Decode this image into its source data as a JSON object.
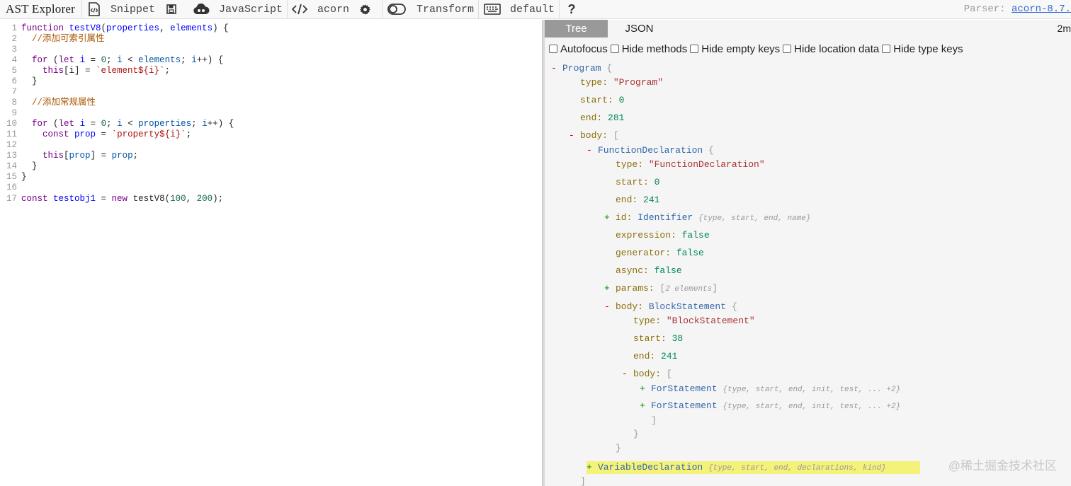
{
  "toolbar": {
    "brand": "AST Explorer",
    "snippet_label": "Snippet",
    "language_label": "JavaScript",
    "parser_label": "acorn",
    "transform_label": "Transform",
    "keymap_label": "default",
    "parser_info_prefix": "Parser: ",
    "parser_info_link": "acorn-8.7."
  },
  "editor": {
    "lines": [
      {
        "n": "1",
        "tokens": [
          [
            "kw",
            "function "
          ],
          [
            "def",
            "testV8"
          ],
          [
            "plain",
            "("
          ],
          [
            "def",
            "properties"
          ],
          [
            "plain",
            ", "
          ],
          [
            "def",
            "elements"
          ],
          [
            "plain",
            ") {"
          ]
        ]
      },
      {
        "n": "2",
        "tokens": [
          [
            "plain",
            "  "
          ],
          [
            "cm",
            "//添加可索引属性"
          ]
        ]
      },
      {
        "n": "3",
        "tokens": []
      },
      {
        "n": "4",
        "tokens": [
          [
            "plain",
            "  "
          ],
          [
            "kw",
            "for"
          ],
          [
            "plain",
            " ("
          ],
          [
            "kw",
            "let "
          ],
          [
            "def",
            "i"
          ],
          [
            "plain",
            " = "
          ],
          [
            "num",
            "0"
          ],
          [
            "plain",
            "; "
          ],
          [
            "var",
            "i"
          ],
          [
            "plain",
            " < "
          ],
          [
            "var",
            "elements"
          ],
          [
            "plain",
            "; "
          ],
          [
            "var",
            "i"
          ],
          [
            "plain",
            "++) {"
          ]
        ]
      },
      {
        "n": "5",
        "tokens": [
          [
            "plain",
            "    "
          ],
          [
            "kw",
            "this"
          ],
          [
            "plain",
            "[i] = "
          ],
          [
            "str",
            "`element${i}`"
          ],
          [
            "plain",
            ";"
          ]
        ]
      },
      {
        "n": "6",
        "tokens": [
          [
            "plain",
            "  }"
          ]
        ]
      },
      {
        "n": "7",
        "tokens": []
      },
      {
        "n": "8",
        "tokens": [
          [
            "plain",
            "  "
          ],
          [
            "cm",
            "//添加常规属性"
          ]
        ]
      },
      {
        "n": "9",
        "tokens": []
      },
      {
        "n": "10",
        "tokens": [
          [
            "plain",
            "  "
          ],
          [
            "kw",
            "for"
          ],
          [
            "plain",
            " ("
          ],
          [
            "kw",
            "let "
          ],
          [
            "def",
            "i"
          ],
          [
            "plain",
            " = "
          ],
          [
            "num",
            "0"
          ],
          [
            "plain",
            "; "
          ],
          [
            "var",
            "i"
          ],
          [
            "plain",
            " < "
          ],
          [
            "var",
            "properties"
          ],
          [
            "plain",
            "; "
          ],
          [
            "var",
            "i"
          ],
          [
            "plain",
            "++) {"
          ]
        ]
      },
      {
        "n": "11",
        "tokens": [
          [
            "plain",
            "    "
          ],
          [
            "kw",
            "const "
          ],
          [
            "def",
            "prop"
          ],
          [
            "plain",
            " = "
          ],
          [
            "str",
            "`property${i}`"
          ],
          [
            "plain",
            ";"
          ]
        ]
      },
      {
        "n": "12",
        "tokens": []
      },
      {
        "n": "13",
        "tokens": [
          [
            "plain",
            "    "
          ],
          [
            "kw",
            "this"
          ],
          [
            "plain",
            "["
          ],
          [
            "var",
            "prop"
          ],
          [
            "plain",
            "] = "
          ],
          [
            "var",
            "prop"
          ],
          [
            "plain",
            ";"
          ]
        ]
      },
      {
        "n": "14",
        "tokens": [
          [
            "plain",
            "  }"
          ]
        ]
      },
      {
        "n": "15",
        "tokens": [
          [
            "plain",
            "}"
          ]
        ]
      },
      {
        "n": "16",
        "tokens": []
      },
      {
        "n": "17",
        "tokens": [
          [
            "kw",
            "const "
          ],
          [
            "def",
            "testobj1"
          ],
          [
            "plain",
            " = "
          ],
          [
            "kw",
            "new "
          ],
          [
            "plain",
            "testV8("
          ],
          [
            "num",
            "100"
          ],
          [
            "plain",
            ", "
          ],
          [
            "num",
            "200"
          ],
          [
            "plain",
            ");"
          ]
        ]
      }
    ]
  },
  "output": {
    "tabs": [
      {
        "label": "Tree",
        "active": true
      },
      {
        "label": "JSON",
        "active": false
      }
    ],
    "elapsed": "2m",
    "options": [
      {
        "label": "Autofocus",
        "checked": false
      },
      {
        "label": "Hide methods",
        "checked": false
      },
      {
        "label": "Hide empty keys",
        "checked": false
      },
      {
        "label": "Hide location data",
        "checked": false
      },
      {
        "label": "Hide type keys",
        "checked": false
      }
    ],
    "tree": [
      {
        "depth": 0,
        "toggle": "-",
        "parts": [
          [
            "type-name",
            "Program"
          ],
          [
            "br",
            "    {"
          ]
        ]
      },
      {
        "depth": 1,
        "toggle": "",
        "parts": [
          [
            "key",
            "type:  "
          ],
          [
            "sv",
            "\"Program\""
          ]
        ]
      },
      {
        "depth": 1,
        "toggle": "",
        "parts": [
          [
            "key",
            "start:  "
          ],
          [
            "nv",
            "0"
          ]
        ]
      },
      {
        "depth": 1,
        "toggle": "",
        "parts": [
          [
            "key",
            "end:  "
          ],
          [
            "nv",
            "281"
          ]
        ]
      },
      {
        "depth": 1,
        "toggle": "-",
        "parts": [
          [
            "key",
            "body:  "
          ],
          [
            "br",
            "    ["
          ]
        ]
      },
      {
        "depth": 2,
        "toggle": "-",
        "parts": [
          [
            "type-name",
            "FunctionDeclaration"
          ],
          [
            "br",
            "    {"
          ]
        ]
      },
      {
        "depth": 3,
        "toggle": "",
        "parts": [
          [
            "key",
            "type:  "
          ],
          [
            "sv",
            "\"FunctionDeclaration\""
          ]
        ]
      },
      {
        "depth": 3,
        "toggle": "",
        "parts": [
          [
            "key",
            "start:  "
          ],
          [
            "nv",
            "0"
          ]
        ]
      },
      {
        "depth": 3,
        "toggle": "",
        "parts": [
          [
            "key",
            "end:  "
          ],
          [
            "nv",
            "241"
          ]
        ]
      },
      {
        "depth": 3,
        "toggle": "+",
        "parts": [
          [
            "key",
            "id:  "
          ],
          [
            "type-name",
            "Identifier "
          ],
          [
            "sum",
            "{type, start, end, name}"
          ]
        ]
      },
      {
        "depth": 3,
        "toggle": "",
        "parts": [
          [
            "key",
            "expression:  "
          ],
          [
            "nv",
            "false"
          ]
        ]
      },
      {
        "depth": 3,
        "toggle": "",
        "parts": [
          [
            "key",
            "generator:  "
          ],
          [
            "nv",
            "false"
          ]
        ]
      },
      {
        "depth": 3,
        "toggle": "",
        "parts": [
          [
            "key",
            "async:  "
          ],
          [
            "nv",
            "false"
          ]
        ]
      },
      {
        "depth": 3,
        "toggle": "+",
        "parts": [
          [
            "key",
            "params:  "
          ],
          [
            "br",
            "["
          ],
          [
            "sum",
            "2 elements"
          ],
          [
            "br",
            "]"
          ]
        ]
      },
      {
        "depth": 3,
        "toggle": "-",
        "parts": [
          [
            "key",
            "body:  "
          ],
          [
            "type-name",
            "BlockStatement"
          ],
          [
            "br",
            "    {"
          ]
        ]
      },
      {
        "depth": 4,
        "toggle": "",
        "parts": [
          [
            "key",
            "type:  "
          ],
          [
            "sv",
            "\"BlockStatement\""
          ]
        ]
      },
      {
        "depth": 4,
        "toggle": "",
        "parts": [
          [
            "key",
            "start:  "
          ],
          [
            "nv",
            "38"
          ]
        ]
      },
      {
        "depth": 4,
        "toggle": "",
        "parts": [
          [
            "key",
            "end:  "
          ],
          [
            "nv",
            "241"
          ]
        ]
      },
      {
        "depth": 4,
        "toggle": "-",
        "parts": [
          [
            "key",
            "body:  "
          ],
          [
            "br",
            "    ["
          ]
        ]
      },
      {
        "depth": 5,
        "toggle": "+",
        "parts": [
          [
            "type-name",
            "ForStatement "
          ],
          [
            "sum",
            "{type, start, end, init, test, ... +2}"
          ]
        ]
      },
      {
        "depth": 5,
        "toggle": "+",
        "parts": [
          [
            "type-name",
            "ForStatement "
          ],
          [
            "sum",
            "{type, start, end, init, test, ... +2}"
          ]
        ]
      },
      {
        "depth": 5,
        "toggle": "",
        "parts": [
          [
            "br",
            "]"
          ]
        ]
      },
      {
        "depth": 4,
        "toggle": "",
        "parts": [
          [
            "br",
            "}"
          ]
        ]
      },
      {
        "depth": 3,
        "toggle": "",
        "parts": [
          [
            "br",
            "}"
          ]
        ]
      },
      {
        "depth": 2,
        "toggle": "+",
        "highlight": true,
        "parts": [
          [
            "type-name",
            "VariableDeclaration "
          ],
          [
            "sum",
            "{type, start, end, declarations, kind}"
          ]
        ]
      },
      {
        "depth": 1,
        "toggle": "",
        "parts": [
          [
            "br",
            "]"
          ]
        ]
      }
    ]
  },
  "watermark": "@稀土掘金技术社区",
  "colors": {
    "toolbar_bg": "#f8f8f8",
    "active_tab_bg": "#999999",
    "panel_bg": "#f5f5f5",
    "highlight": "#f5f27a",
    "link": "#3366cc"
  }
}
